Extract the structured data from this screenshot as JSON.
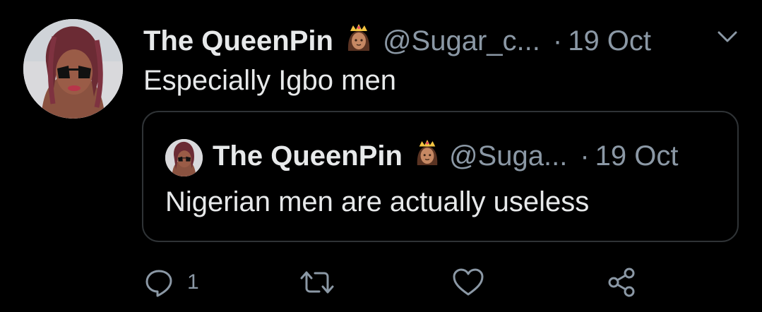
{
  "tweet": {
    "display_name": "The QueenPin",
    "handle": "@Sugar_c...",
    "dot": "·",
    "time": "19 Oct",
    "text": "Especially Igbo men",
    "badge_emoji": "princess-emoji"
  },
  "quoted_tweet": {
    "display_name": "The QueenPin",
    "handle": "@Suga...",
    "dot": "·",
    "time": "19 Oct",
    "text": "Nigerian men are actually useless",
    "badge_emoji": "princess-emoji"
  },
  "actions": {
    "reply_count": "1",
    "icons": [
      "reply-icon",
      "retweet-icon",
      "like-icon",
      "share-icon"
    ]
  },
  "colors": {
    "background": "#000000",
    "primary_text": "#e7e9ea",
    "secondary_text": "#8b98a5",
    "border": "#2f3336"
  }
}
